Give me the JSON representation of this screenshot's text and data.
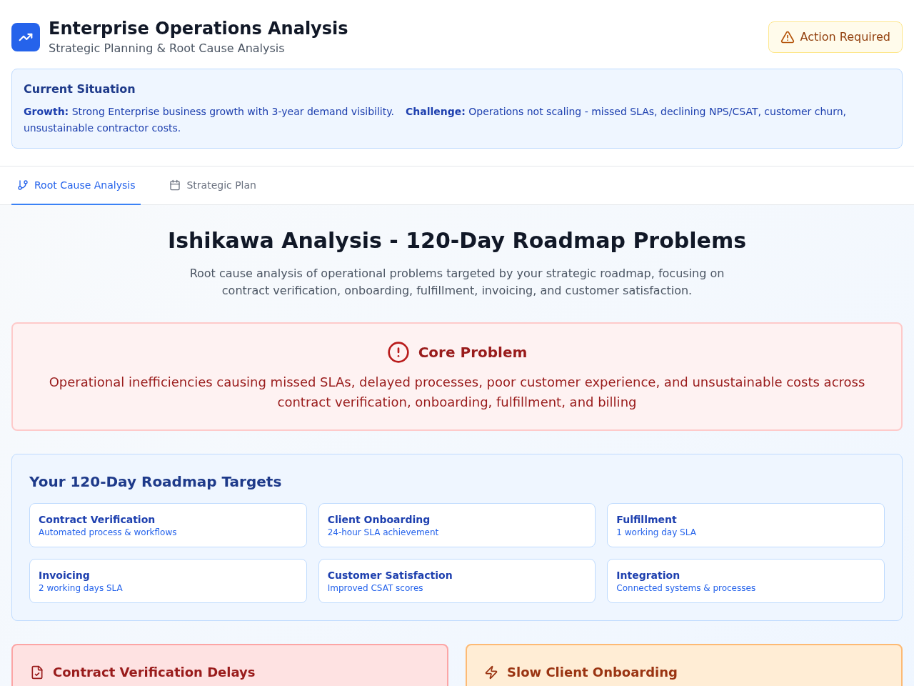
{
  "header": {
    "title": "Enterprise Operations Analysis",
    "subtitle": "Strategic Planning & Root Cause Analysis",
    "badge": {
      "label": "Action Required"
    }
  },
  "situation": {
    "title": "Current Situation",
    "items": [
      "**Growth:** Strong Enterprise business growth with 3-year demand visibility.",
      "**Challenge:** Operations not scaling - missed SLAs, declining NPS/CSAT, customer churn, unsustainable contractor costs."
    ]
  },
  "tabs": [
    {
      "label": "Root Cause Analysis",
      "selected": true
    },
    {
      "label": "Strategic Plan",
      "selected": false
    }
  ],
  "analysis": {
    "title": "Ishikawa Analysis - 120-Day Roadmap Problems",
    "description": "Root cause analysis of operational problems targeted by your strategic roadmap, focusing on contract verification, onboarding, fulfillment, invoicing, and customer satisfaction."
  },
  "core_problem": {
    "title": "Core Problem",
    "text": "Operational inefficiencies causing missed SLAs, delayed processes, poor customer experience, and unsustainable costs across contract verification, onboarding, fulfillment, and billing"
  },
  "targets": {
    "title": "Your 120-Day Roadmap Targets",
    "items": [
      {
        "title": "Contract Verification",
        "subtitle": "Automated process & workflows"
      },
      {
        "title": "Client Onboarding",
        "subtitle": "24-hour SLA achievement"
      },
      {
        "title": "Fulfillment",
        "subtitle": "1 working day SLA"
      },
      {
        "title": "Invoicing",
        "subtitle": "2 working days SLA"
      },
      {
        "title": "Customer Satisfaction",
        "subtitle": "Improved CSAT scores"
      },
      {
        "title": "Integration",
        "subtitle": "Connected systems & processes"
      }
    ]
  },
  "problems": [
    {
      "title": "Contract Verification Delays",
      "kind": "critical"
    },
    {
      "title": "Slow Client Onboarding",
      "kind": "major"
    }
  ]
}
